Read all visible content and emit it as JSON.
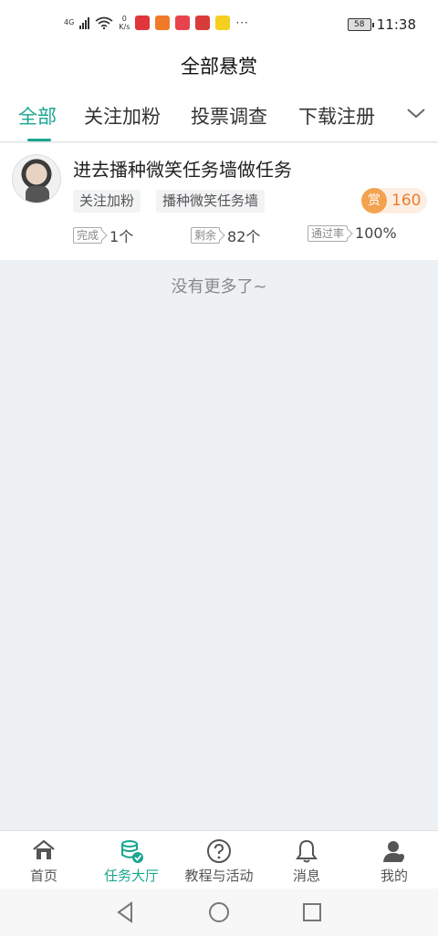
{
  "status_bar": {
    "network_type": "4G",
    "speed_value": "0",
    "speed_unit": "K/s",
    "more_dots": "···",
    "battery": "58",
    "time": "11:38"
  },
  "header": {
    "title": "全部悬赏"
  },
  "tabs": {
    "items": [
      {
        "label": "全部"
      },
      {
        "label": "关注加粉"
      },
      {
        "label": "投票调查"
      },
      {
        "label": "下载注册"
      }
    ],
    "more_icon": "chevron-down-icon"
  },
  "task": {
    "title": "进去播种微笑任务墙做任务",
    "tags": [
      "关注加粉",
      "播种微笑任务墙"
    ],
    "reward_badge": "赏",
    "reward_amount": "160",
    "stats": [
      {
        "label": "完成",
        "value": "1个"
      },
      {
        "label": "剩余",
        "value": "82个"
      },
      {
        "label": "通过率",
        "value": "100%"
      }
    ]
  },
  "list_end_text": "没有更多了~",
  "bottom_nav": {
    "items": [
      {
        "label": "首页",
        "icon": "home-icon"
      },
      {
        "label": "任务大厅",
        "icon": "task-hall-icon",
        "active": true
      },
      {
        "label": "教程与活动",
        "icon": "help-icon"
      },
      {
        "label": "消息",
        "icon": "bell-icon"
      },
      {
        "label": "我的",
        "icon": "profile-icon"
      }
    ]
  },
  "colors": {
    "accent": "#1aa690",
    "reward": "#ee7d2a",
    "background": "#eef1f4"
  }
}
